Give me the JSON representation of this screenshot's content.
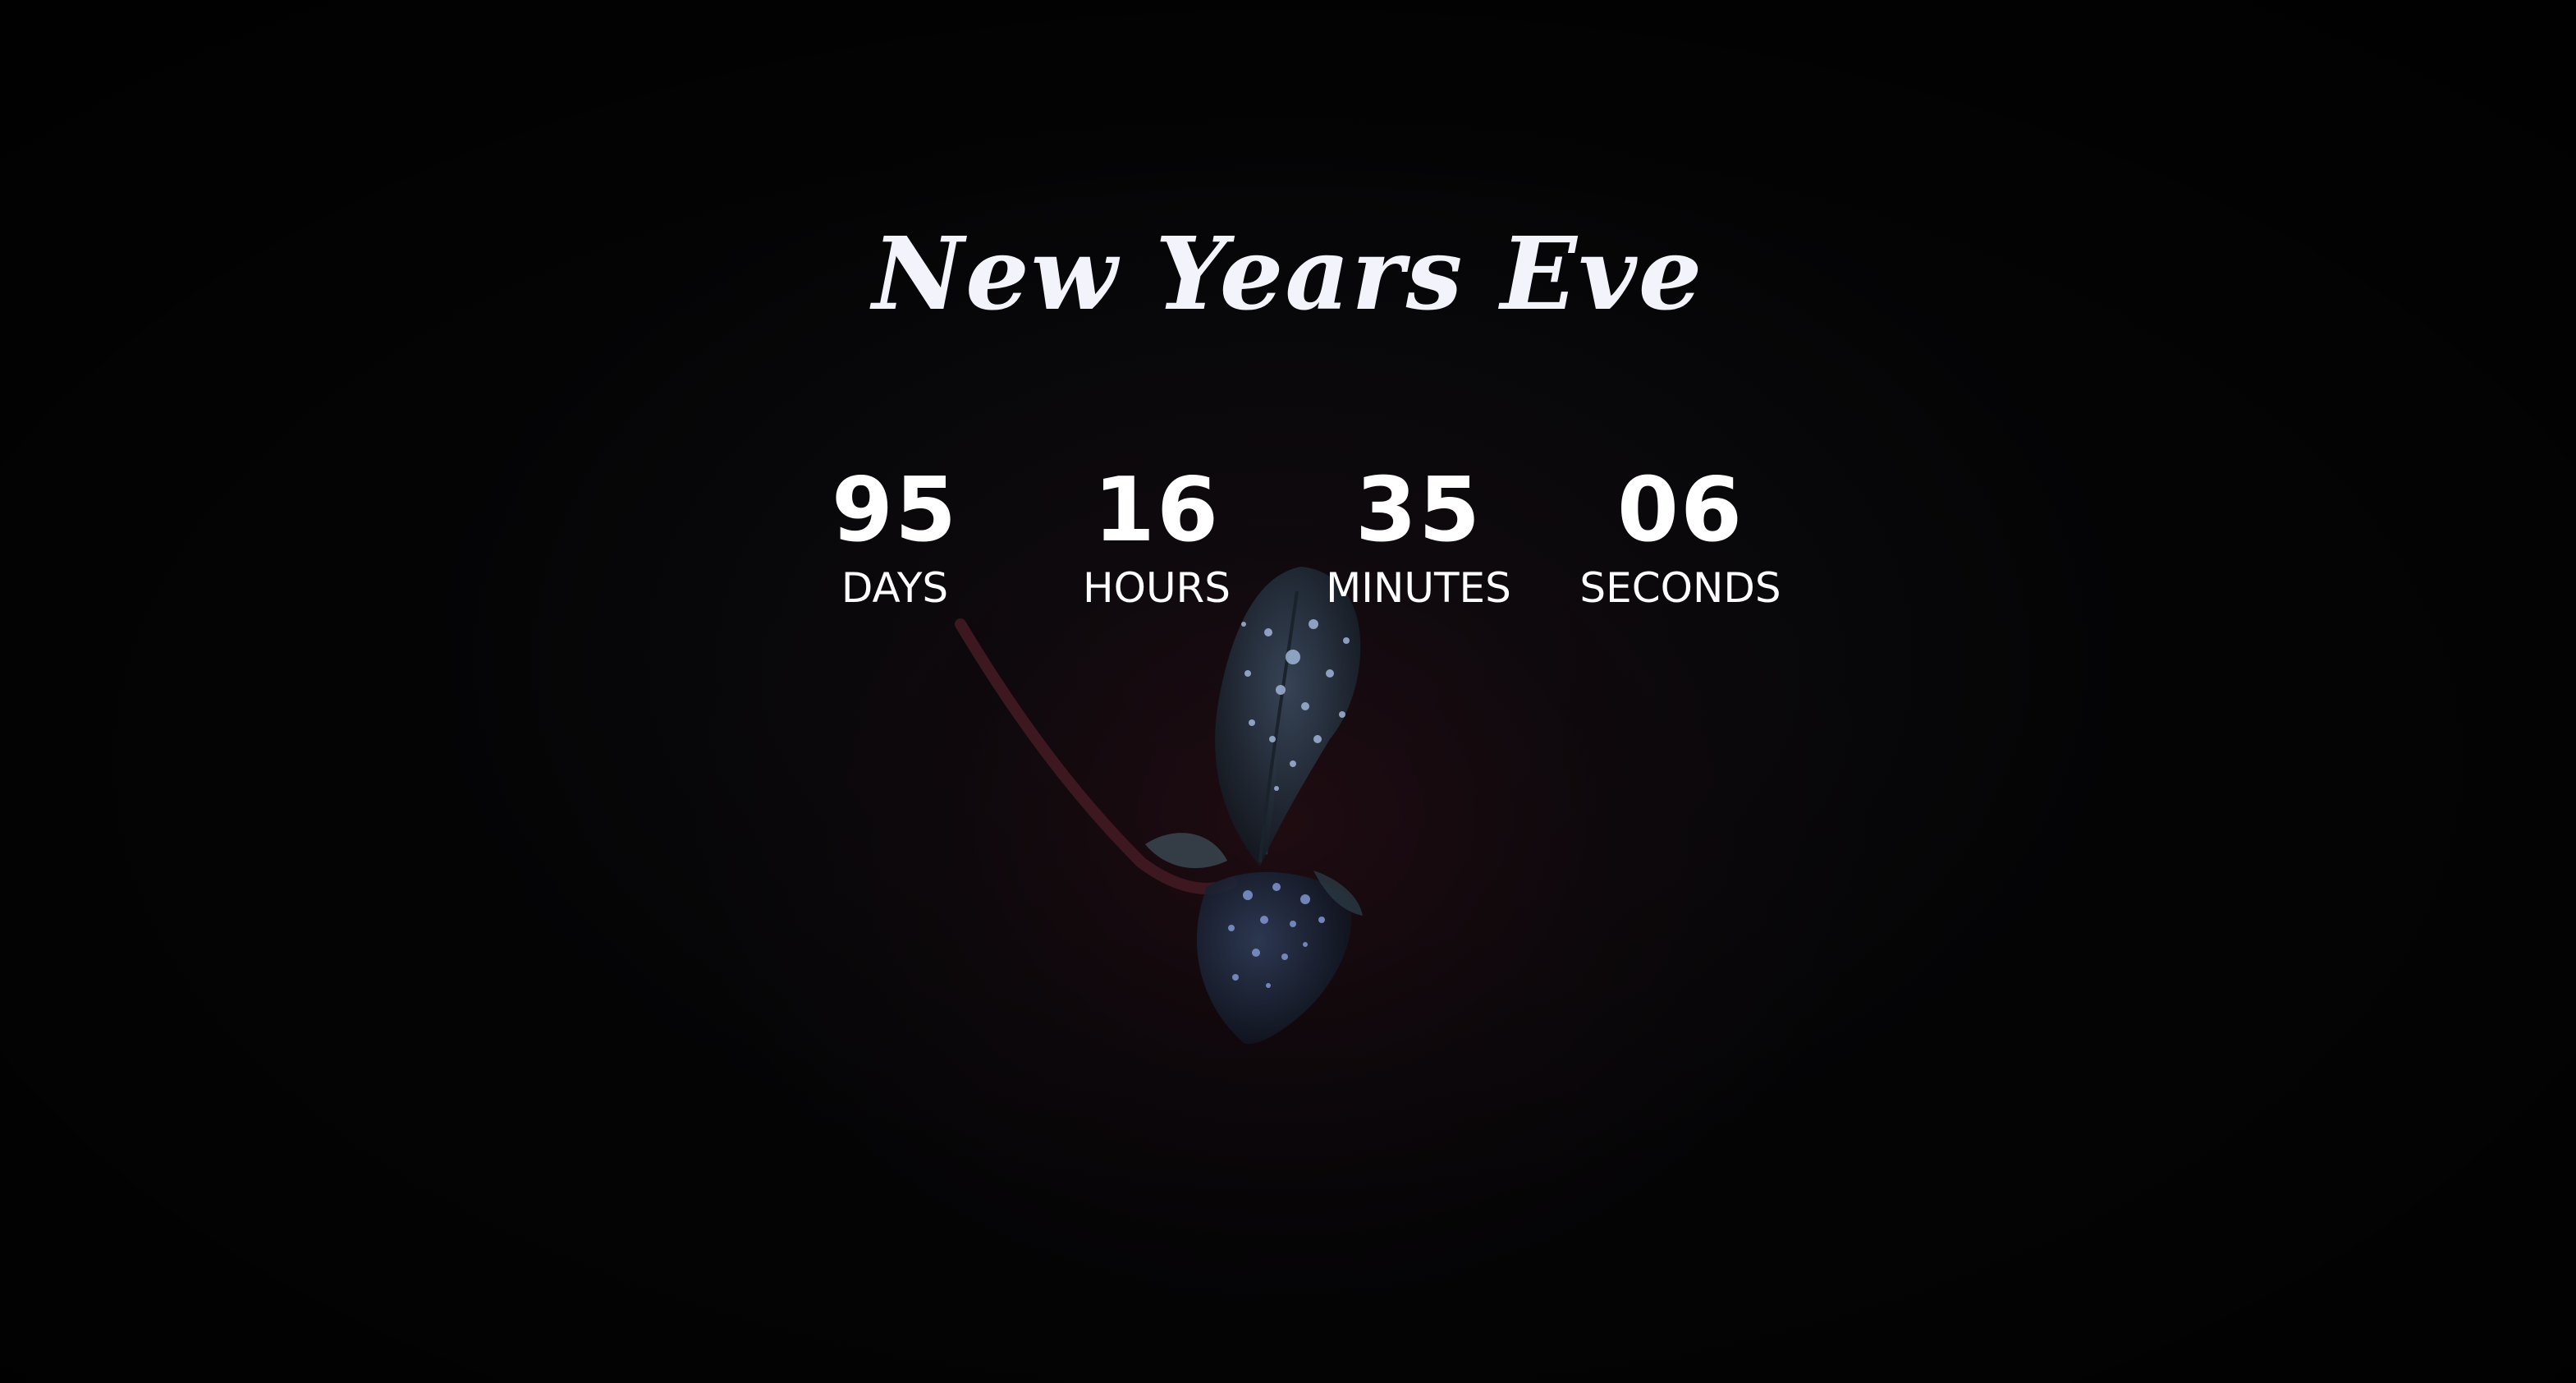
{
  "page": {
    "title": "New Years Eve",
    "background_image": "dark-leaf-with-water-drops"
  },
  "countdown": {
    "days": {
      "value": "95",
      "label": "DAYS"
    },
    "hours": {
      "value": "16",
      "label": "HOURS"
    },
    "minutes": {
      "value": "35",
      "label": "MINUTES"
    },
    "seconds": {
      "value": "06",
      "label": "SECONDS"
    }
  },
  "colors": {
    "background": "#040405",
    "text": "#ffffff",
    "title_text": "#f2f3fb",
    "leaf": "#2a3646",
    "stem": "#4a1a22",
    "droplet": "#9fb4d8"
  }
}
